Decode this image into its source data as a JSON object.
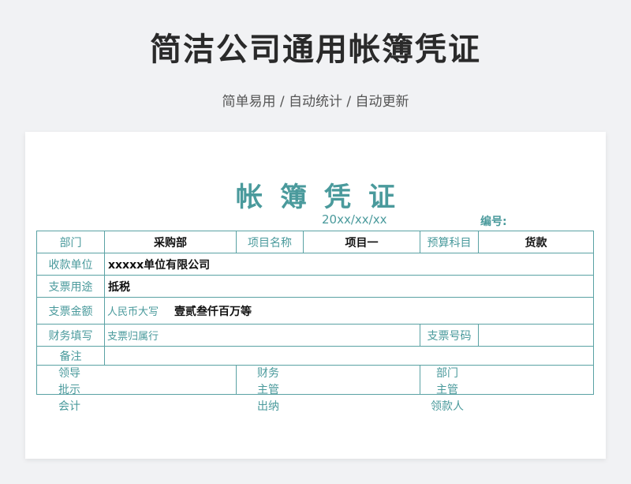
{
  "page": {
    "title": "简洁公司通用帐簿凭证",
    "subtitle": "简单易用 / 自动统计 / 自动更新"
  },
  "voucher": {
    "title": "帐簿凭证",
    "date": "20xx/xx/xx",
    "code_label": "编号:",
    "row1": {
      "dept_label": "部门",
      "dept_value": "采购部",
      "item_label": "项目名称",
      "item_value": "项目一",
      "budget_label": "预算科目",
      "budget_value": "货款"
    },
    "payee_label": "收款单位",
    "payee_value": "xxxxx单位有限公司",
    "purpose_label": "支票用途",
    "purpose_value": "抵税",
    "amount_label": "支票金额",
    "amount_hint": "人民币大写",
    "amount_value": "壹贰叁仟百万等",
    "fin_label": "财务填写",
    "fin_hint": "支票归属行",
    "cheque_no_label": "支票号码",
    "cheque_no_value": "",
    "remark_label": "备注",
    "remark_value": "",
    "signatures": {
      "col1": [
        "领导",
        "批示",
        "会计"
      ],
      "col2": [
        "财务",
        "主管",
        "出纳"
      ],
      "col3": [
        "部门",
        "主管",
        "领款人"
      ]
    }
  },
  "colors": {
    "accent": "#4a9a9c",
    "border": "#5aa2a4"
  }
}
